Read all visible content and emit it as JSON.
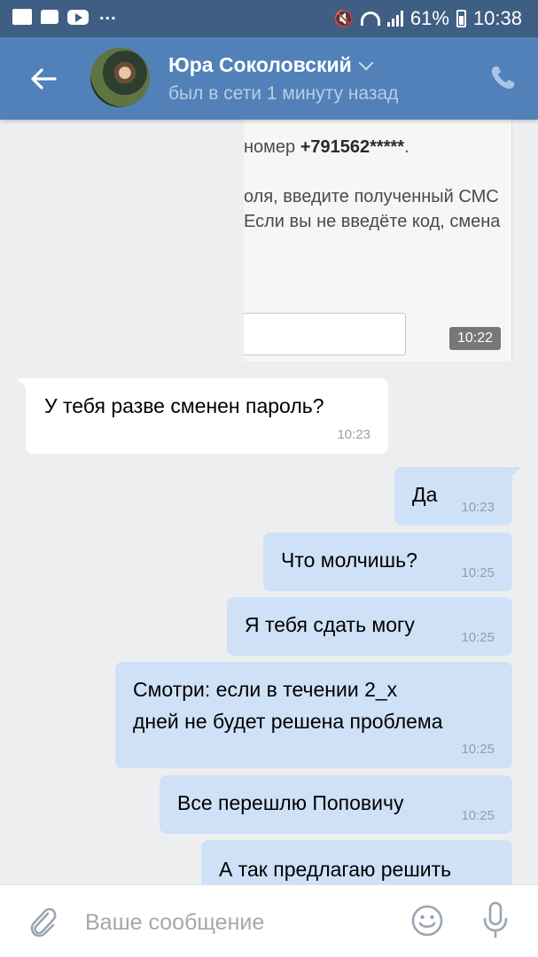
{
  "status_bar": {
    "battery": "61%",
    "time": "10:38",
    "more": "..."
  },
  "header": {
    "name": "Юра Соколовский",
    "presence": "был в сети 1 минуту назад"
  },
  "attachment": {
    "line1_prefix": "номер ",
    "line1_number": "+791562*****",
    "line1_suffix": ".",
    "line2": "оля, введите полученный СМС",
    "line3": "Если вы не введёте код, смена",
    "time": "10:22"
  },
  "messages": [
    {
      "direction": "in",
      "text": "У тебя разве сменен пароль?",
      "time": "10:23"
    },
    {
      "direction": "out",
      "text": "Да",
      "time": "10:23"
    },
    {
      "direction": "out",
      "text": "Что молчишь?",
      "time": "10:25"
    },
    {
      "direction": "out",
      "text": "Я тебя сдать могу",
      "time": "10:25"
    },
    {
      "direction": "out",
      "line1": "Смотри: если в течении  2_х",
      "line2": "дней не будет решена проблема",
      "time": "10:25"
    },
    {
      "direction": "out",
      "text": "Все перешлю Поповичу",
      "time": "10:25"
    },
    {
      "direction": "out",
      "text": "А так предлагаю решить"
    }
  ],
  "composer": {
    "placeholder": "Ваше сообщение"
  },
  "icons": {
    "back": "back-arrow-icon",
    "call": "phone-icon",
    "attach": "paperclip-icon",
    "emoji": "smile-icon",
    "voice": "microphone-icon"
  },
  "colors": {
    "header": "#5181b8",
    "status_bar": "#3f5e84",
    "outgoing_bubble": "#cfe1f6",
    "incoming_bubble": "#ffffff",
    "background": "#edeef0"
  }
}
